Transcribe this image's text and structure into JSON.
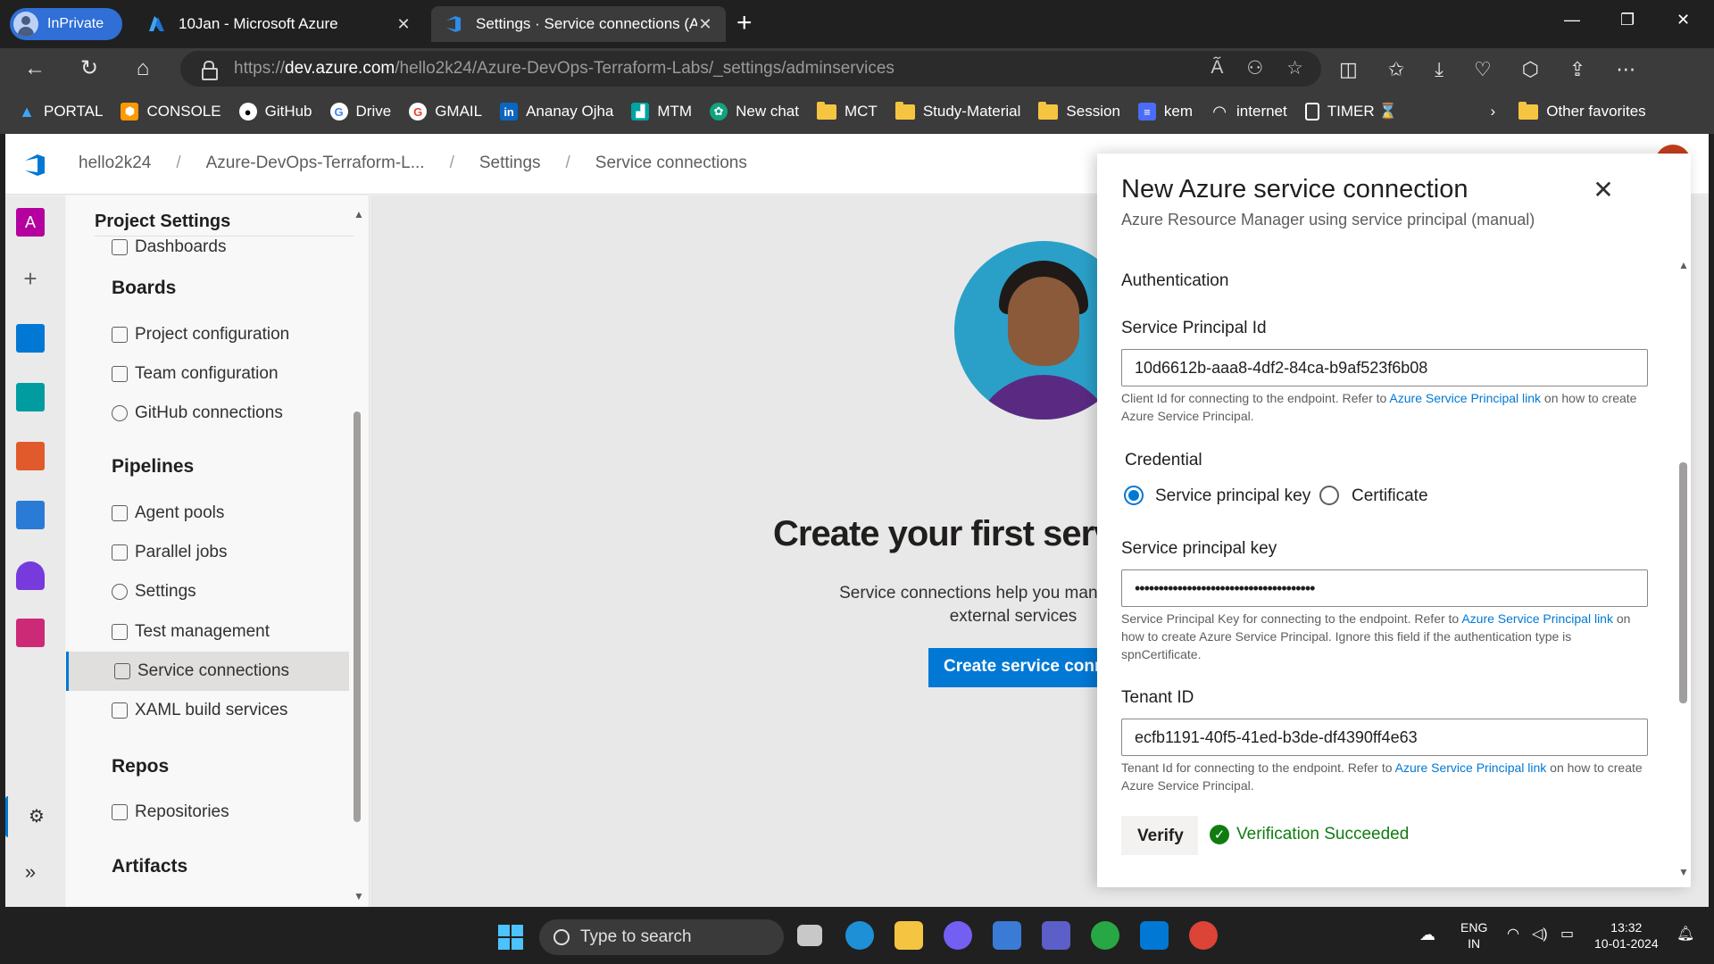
{
  "browser": {
    "profile_label": "InPrivate",
    "tabs": [
      {
        "title": "10Jan - Microsoft Azure",
        "icon": "azure-icon"
      },
      {
        "title": "Settings · Service connections (A",
        "icon": "azure-devops-icon"
      }
    ],
    "url_prefix": "https://",
    "url_host": "dev.azure.com",
    "url_path": "/hello2k24/Azure-DevOps-Terraform-Labs/_settings/adminservices",
    "favorites": [
      {
        "label": "PORTAL",
        "icon": "azure-icon",
        "color": "#0078d4"
      },
      {
        "label": "CONSOLE",
        "icon": "aws-icon",
        "color": "#ff9900"
      },
      {
        "label": "GitHub",
        "icon": "github-icon",
        "color": "#ffffff"
      },
      {
        "label": "Drive",
        "icon": "google-icon",
        "color": "#ffffff"
      },
      {
        "label": "GMAIL",
        "icon": "google-icon",
        "color": "#ffffff"
      },
      {
        "label": "Ananay Ojha",
        "icon": "linkedin-icon",
        "color": "#0a66c2"
      },
      {
        "label": "MTM",
        "icon": "mtm-icon",
        "color": "#00a3a3"
      },
      {
        "label": "New chat",
        "icon": "chatgpt-icon",
        "color": "#10a37f"
      },
      {
        "label": "MCT",
        "icon": "folder-icon",
        "color": "#f5c542"
      },
      {
        "label": "Study-Material",
        "icon": "folder-icon",
        "color": "#f5c542"
      },
      {
        "label": "Session",
        "icon": "folder-icon",
        "color": "#f5c542"
      },
      {
        "label": "kem",
        "icon": "doc-icon",
        "color": "#4a6cf7"
      },
      {
        "label": "internet",
        "icon": "internet-icon",
        "color": "#ffffff"
      },
      {
        "label": "TIMER ⌛",
        "icon": "page-icon",
        "color": "#ffffff"
      }
    ],
    "other_favorites": "Other favorites"
  },
  "breadcrumb": [
    "hello2k24",
    "Azure-DevOps-Terraform-L...",
    "Settings",
    "Service connections"
  ],
  "settings_nav": {
    "title": "Project Settings",
    "partial_item": "Dashboards",
    "sections": [
      {
        "label": "Boards",
        "items": [
          "Project configuration",
          "Team configuration",
          "GitHub connections"
        ]
      },
      {
        "label": "Pipelines",
        "items": [
          "Agent pools",
          "Parallel jobs",
          "Settings",
          "Test management",
          "Service connections",
          "XAML build services"
        ]
      },
      {
        "label": "Repos",
        "items": [
          "Repositories"
        ]
      },
      {
        "label": "Artifacts",
        "items": []
      }
    ],
    "selected": "Service connections"
  },
  "main": {
    "title": "Create your first servi",
    "desc_line1": "Service connections help you manage, protect",
    "desc_line2": "external services",
    "button": "Create service conne"
  },
  "panel": {
    "title": "New Azure service connection",
    "subtitle": "Azure Resource Manager using service principal (manual)",
    "auth_heading": "Authentication",
    "sp_id_label": "Service Principal Id",
    "sp_id_value": "10d6612b-aaa8-4df2-84ca-b9af523f6b08",
    "sp_id_help_pre": "Client Id for connecting to the endpoint. Refer to ",
    "sp_id_help_link": "Azure Service Principal link",
    "sp_id_help_post": " on how to create Azure Service Principal.",
    "credential_label": "Credential",
    "radio_key": "Service principal key",
    "radio_cert": "Certificate",
    "credential_selected": "Service principal key",
    "key_label": "Service principal key",
    "key_value": "••••••••••••••••••••••••••••••••••••••",
    "key_help_pre": "Service Principal Key for connecting to the endpoint. Refer to ",
    "key_help_link": "Azure Service Principal link",
    "key_help_post": " on how to create Azure Service Principal. Ignore this field if the authentication type is spnCertificate.",
    "tenant_label": "Tenant ID",
    "tenant_value": "ecfb1191-40f5-41ed-b3de-df4390ff4e63",
    "tenant_help_pre": "Tenant Id for connecting to the endpoint. Refer to ",
    "tenant_help_link": "Azure Service Principal link",
    "tenant_help_post": " on how to create Azure Service Principal.",
    "verify_button": "Verify",
    "verify_status": "Verification Succeeded"
  },
  "taskbar": {
    "search_placeholder": "Type to search",
    "lang_line1": "ENG",
    "lang_line2": "IN",
    "time": "13:32",
    "date": "10-01-2024"
  },
  "colors": {
    "accent": "#0078d4",
    "success": "#107c10",
    "inprivate": "#2f6fd6"
  }
}
